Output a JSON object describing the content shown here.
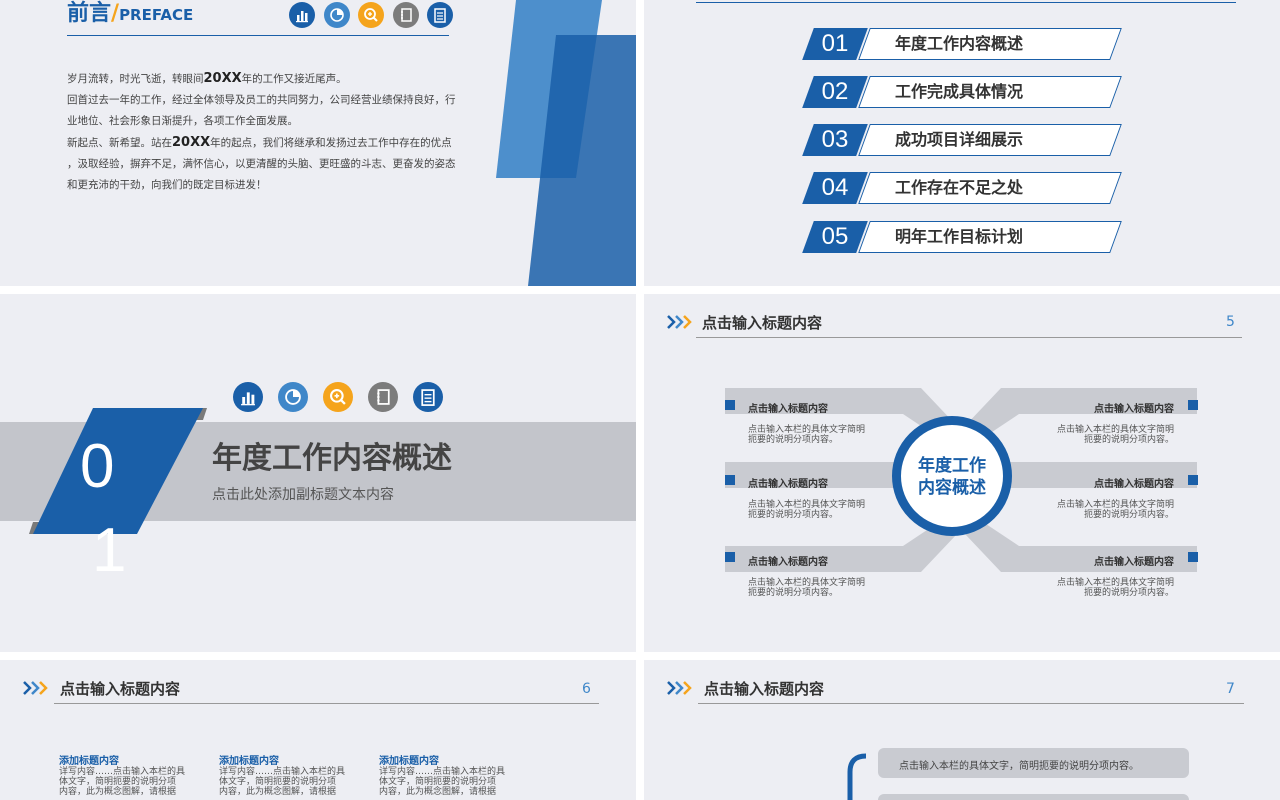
{
  "slide1": {
    "title_cn": "前言",
    "title_sep": "/",
    "title_en": "PREFACE",
    "paragraphs": [
      {
        "pre": "岁月流转，时光飞逝，转眼间",
        "bold": "20XX",
        "post": "年的工作又接近尾声。"
      },
      {
        "pre": "回首过去一年的工作，经过全体领导及员工的共同努力，公司经营业绩保持良好，行",
        "bold": "",
        "post": ""
      },
      {
        "pre": "业地位、社会形象日渐提升，各项工作全面发展。",
        "bold": "",
        "post": ""
      },
      {
        "pre": "新起点、新希望。站在",
        "bold": "20XX",
        "post": "年的起点，我们将继承和发扬过去工作中存在的优点"
      },
      {
        "pre": "，汲取经验，摒弃不足，满怀信心，以更清醒的头脑、更旺盛的斗志、更奋发的姿态",
        "bold": "",
        "post": ""
      },
      {
        "pre": "和更充沛的干劲，向我们的既定目标进发！",
        "bold": "",
        "post": ""
      }
    ]
  },
  "slide2": {
    "items": [
      {
        "num": "01",
        "label": "年度工作内容概述"
      },
      {
        "num": "02",
        "label": "工作完成具体情况"
      },
      {
        "num": "03",
        "label": "成功项目详细展示"
      },
      {
        "num": "04",
        "label": "工作存在不足之处"
      },
      {
        "num": "05",
        "label": "明年工作目标计划"
      }
    ]
  },
  "slide3": {
    "num_top": "0",
    "num_bottom": "1",
    "title": "年度工作内容概述",
    "subtitle": "点击此处添加副标题文本内容"
  },
  "slide4": {
    "header": "点击输入标题内容",
    "page": "5",
    "center_line1": "年度工作",
    "center_line2": "内容概述",
    "item_title": "点击输入标题内容",
    "item_desc1": "点击输入本栏的具体文字简明",
    "item_desc2": "扼要的说明分项内容。"
  },
  "slide5": {
    "header": "点击输入标题内容",
    "page": "6",
    "cols": [
      {
        "title": "添加标题内容",
        "l1": "详写内容……点击输入本栏的具",
        "l2": "体文字，简明扼要的说明分项",
        "l3": "内容，此为概念图解，请根据"
      },
      {
        "title": "添加标题内容",
        "l1": "详写内容……点击输入本栏的具",
        "l2": "体文字，简明扼要的说明分项",
        "l3": "内容，此为概念图解，请根据"
      },
      {
        "title": "添加标题内容",
        "l1": "详写内容……点击输入本栏的具",
        "l2": "体文字，简明扼要的说明分项",
        "l3": "内容，此为概念图解，请根据"
      }
    ]
  },
  "slide6": {
    "header": "点击输入标题内容",
    "page": "7",
    "bar_text": "点击输入本栏的具体文字，简明扼要的说明分项内容。"
  },
  "icons": [
    "bar-chart-icon",
    "pie-chart-icon",
    "search-icon",
    "notebook-icon",
    "clipboard-icon"
  ],
  "colors": {
    "primary": "#1a5fa8",
    "light_blue": "#3f87c9",
    "orange": "#f5a41c",
    "gray": "#7c7c7c",
    "bar_gray": "#c9cbd1",
    "slide_bg": "#edeef3"
  }
}
